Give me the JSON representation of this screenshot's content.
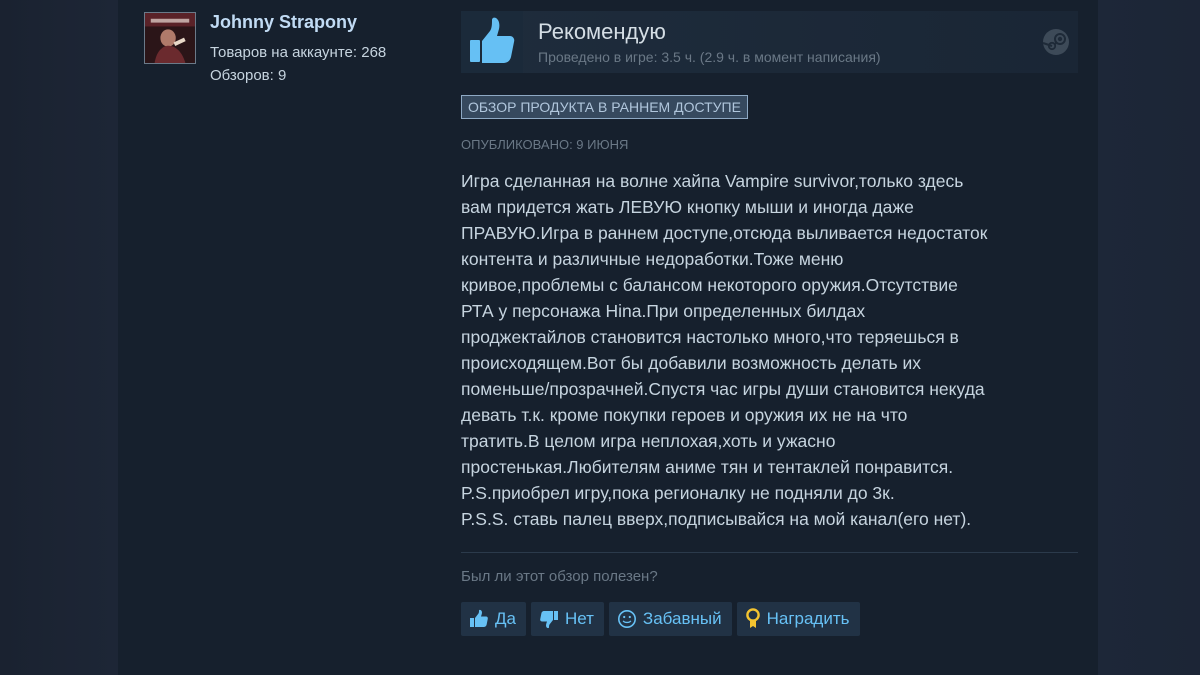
{
  "user": {
    "name": "Johnny Strapony",
    "products_label": "Товаров на аккаунте: 268",
    "reviews_label": "Обзоров: 9"
  },
  "review": {
    "verdict": "Рекомендую",
    "playtime": "Проведено в игре: 3.5 ч. (2.9 ч. в момент написания)",
    "badge": "ОБЗОР ПРОДУКТА В РАННЕМ ДОСТУПЕ",
    "posted": "ОПУБЛИКОВАНО: 9 ИЮНЯ",
    "lines": [
      "Игра сделанная на волне хайпа Vampire survivor,только здесь",
      "вам придется жать ЛЕВУЮ кнопку мыши и иногда даже",
      "ПРАВУЮ.Игра в раннем доступе,отсюда выливается недостаток",
      "контента и различные недоработки.Тоже меню",
      "кривое,проблемы с балансом некоторого оружия.Отсутствие",
      "РТА у персонажа Hina.При определенных билдах",
      "проджектайлов становится настолько много,что теряешься в",
      "происходящем.Вот бы добавили возможность делать их",
      "поменьше/прозрачней.Спустя час игры души становится некуда",
      "девать т.к. кроме покупки героев и оружия их не на что",
      "тратить.В целом игра неплохая,хоть и ужасно",
      "простенькая.Любителям аниме тян и тентаклей понравится.",
      "P.S.приобрел игру,пока регионалку не подняли до 3к.",
      "P.S.S. ставь палец вверх,подписывайся на мой канал(его нет)."
    ]
  },
  "feedback": {
    "question": "Был ли этот обзор полезен?",
    "yes": "Да",
    "no": "Нет",
    "funny": "Забавный",
    "award": "Наградить"
  },
  "icons": {
    "thumb": "thumbs-up-icon",
    "steam": "steam-logo-icon",
    "yes": "thumbs-up-icon",
    "no": "thumbs-down-icon",
    "funny": "smiley-icon",
    "award": "award-icon"
  },
  "colors": {
    "accent_blue": "#67c1f5",
    "thumb_blue": "#66c0f4",
    "award_gold": "#f4c430",
    "panel": "#16202d"
  }
}
